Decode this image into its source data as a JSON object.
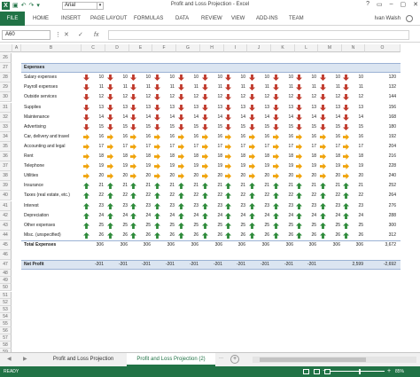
{
  "window": {
    "title": "Profit and Loss Projection - Excel",
    "controls": [
      "?",
      "▭",
      "–",
      "▢",
      "✕"
    ]
  },
  "qat": {
    "font_name": "Arial"
  },
  "ribbon": {
    "file": "FILE",
    "tabs": [
      "HOME",
      "INSERT",
      "PAGE LAYOUT",
      "FORMULAS",
      "DATA",
      "REVIEW",
      "VIEW",
      "ADD-INS",
      "TEAM"
    ],
    "user": "Ivan Walsh"
  },
  "formula_bar": {
    "name_box": "A60",
    "fx": "fx",
    "formula": ""
  },
  "columns": [
    "A",
    "B",
    "C",
    "D",
    "E",
    "F",
    "G",
    "H",
    "I",
    "J",
    "K",
    "L",
    "M",
    "N",
    "O"
  ],
  "row_numbers": [
    "26",
    "27",
    "28",
    "29",
    "30",
    "31",
    "32",
    "33",
    "34",
    "35",
    "36",
    "37",
    "38",
    "39",
    "40",
    "41",
    "42",
    "43",
    "44",
    "45",
    "46",
    "47",
    "48",
    "49",
    "50",
    "51",
    "52",
    "53",
    "54",
    "55",
    "56",
    "57",
    "58",
    "59",
    "60",
    "61"
  ],
  "colors": {
    "accent": "#217346",
    "band": "#dbe5f1",
    "up": "#2e8b3a",
    "flat": "#f0a30a",
    "down": "#c0392b"
  },
  "section": {
    "title": "Expenses"
  },
  "expenses": [
    {
      "label": "Salary expenses",
      "arrow": "down",
      "values": [
        "10",
        "10",
        "10",
        "10",
        "10",
        "10",
        "10",
        "10",
        "10",
        "10",
        "10",
        "10"
      ],
      "total": "120"
    },
    {
      "label": "Payroll expenses",
      "arrow": "down",
      "values": [
        "11",
        "11",
        "11",
        "11",
        "11",
        "11",
        "11",
        "11",
        "11",
        "11",
        "11",
        "11"
      ],
      "total": "132"
    },
    {
      "label": "Outside services",
      "arrow": "down",
      "values": [
        "12",
        "12",
        "12",
        "12",
        "12",
        "12",
        "12",
        "12",
        "12",
        "12",
        "12",
        "12"
      ],
      "total": "144"
    },
    {
      "label": "Supplies",
      "arrow": "down",
      "values": [
        "13",
        "13",
        "13",
        "13",
        "13",
        "13",
        "13",
        "13",
        "13",
        "13",
        "13",
        "13"
      ],
      "total": "156"
    },
    {
      "label": "Maintenance",
      "arrow": "down",
      "values": [
        "14",
        "14",
        "14",
        "14",
        "14",
        "14",
        "14",
        "14",
        "14",
        "14",
        "14",
        "14"
      ],
      "total": "168"
    },
    {
      "label": "Advertising",
      "arrow": "down",
      "values": [
        "15",
        "15",
        "15",
        "15",
        "15",
        "15",
        "15",
        "15",
        "15",
        "15",
        "15",
        "15"
      ],
      "total": "180"
    },
    {
      "label": "Car, delivery and travel",
      "arrow": "flat",
      "values": [
        "16",
        "16",
        "16",
        "16",
        "16",
        "16",
        "16",
        "16",
        "16",
        "16",
        "16",
        "16"
      ],
      "total": "192"
    },
    {
      "label": "Accounting and legal",
      "arrow": "flat",
      "values": [
        "17",
        "17",
        "17",
        "17",
        "17",
        "17",
        "17",
        "17",
        "17",
        "17",
        "17",
        "17"
      ],
      "total": "204"
    },
    {
      "label": "Rent",
      "arrow": "flat",
      "values": [
        "18",
        "18",
        "18",
        "18",
        "18",
        "18",
        "18",
        "18",
        "18",
        "18",
        "18",
        "18"
      ],
      "total": "216"
    },
    {
      "label": "Telephone",
      "arrow": "flat",
      "values": [
        "19",
        "19",
        "19",
        "19",
        "19",
        "19",
        "19",
        "19",
        "19",
        "19",
        "19",
        "19"
      ],
      "total": "228"
    },
    {
      "label": "Utilities",
      "arrow": "flat",
      "values": [
        "20",
        "20",
        "20",
        "20",
        "20",
        "20",
        "20",
        "20",
        "20",
        "20",
        "20",
        "20"
      ],
      "total": "240"
    },
    {
      "label": "Insurance",
      "arrow": "up",
      "values": [
        "21",
        "21",
        "21",
        "21",
        "21",
        "21",
        "21",
        "21",
        "21",
        "21",
        "21",
        "21"
      ],
      "total": "252"
    },
    {
      "label": "Taxes (real estate, etc.)",
      "arrow": "up",
      "values": [
        "22",
        "22",
        "22",
        "22",
        "22",
        "22",
        "22",
        "22",
        "22",
        "22",
        "22",
        "22"
      ],
      "total": "264"
    },
    {
      "label": "Interest",
      "arrow": "up",
      "values": [
        "23",
        "23",
        "23",
        "23",
        "23",
        "23",
        "23",
        "23",
        "23",
        "23",
        "23",
        "23"
      ],
      "total": "276"
    },
    {
      "label": "Depreciation",
      "arrow": "up",
      "values": [
        "24",
        "24",
        "24",
        "24",
        "24",
        "24",
        "24",
        "24",
        "24",
        "24",
        "24",
        "24"
      ],
      "total": "288"
    },
    {
      "label": "Other expenses",
      "arrow": "up",
      "values": [
        "25",
        "25",
        "25",
        "25",
        "25",
        "25",
        "25",
        "25",
        "25",
        "25",
        "25",
        "25"
      ],
      "total": "300"
    },
    {
      "label": "Misc. (unspecified)",
      "arrow": "up",
      "values": [
        "26",
        "26",
        "26",
        "26",
        "26",
        "26",
        "26",
        "26",
        "26",
        "26",
        "26",
        "26"
      ],
      "total": "312"
    }
  ],
  "total_expenses": {
    "label": "Total Expenses",
    "values": [
      "306",
      "306",
      "306",
      "306",
      "306",
      "306",
      "306",
      "306",
      "306",
      "306",
      "306",
      "306"
    ],
    "total": "3,672"
  },
  "net_profit": {
    "label": "Net Profit",
    "values": [
      "-201",
      "-201",
      "-201",
      "-201",
      "-201",
      "-201",
      "-201",
      "-201",
      "-201",
      "-201",
      "2,599",
      "-2,692"
    ]
  },
  "sheet_tabs": {
    "tabs": [
      "Profit and Loss Projection",
      "Profit and Loss Projection (2)"
    ],
    "active": 1,
    "ellipsis": "...",
    "add": "+"
  },
  "status_bar": {
    "ready": "READY",
    "zoom": "85%",
    "zoom_minus": "−",
    "zoom_plus": "+"
  }
}
